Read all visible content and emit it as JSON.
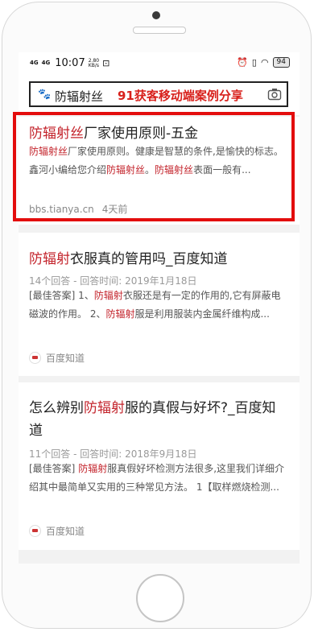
{
  "status_bar": {
    "network_left": "4G",
    "network_right": "4G",
    "time": "10:07",
    "speed_value": "2.80",
    "speed_unit": "KB/s",
    "battery": "94"
  },
  "search": {
    "query": "防辐射丝",
    "overlay_text": "91获客移动端案例分享"
  },
  "results": [
    {
      "title_parts": [
        "防辐射丝",
        "厂家使用原则-五金"
      ],
      "snippet_parts": [
        "防辐射丝",
        "厂家使用原则。健康是智慧的条件,是愉快的标志。鑫河小编给您介绍",
        "防辐射丝",
        "。",
        "防辐射丝",
        "表面一般有..."
      ],
      "source": "bbs.tianya.cn",
      "age": "4天前"
    },
    {
      "title_parts": [
        "防辐射",
        "衣服真的管用吗_百度知道"
      ],
      "meta": "14个回答 - 回答时间: 2019年1月18日",
      "snippet_parts": [
        "[最佳答案] 1、",
        "防辐射",
        "衣服还是有一定的作用的,它有屏蔽电磁波的作用。 2、",
        "防辐射",
        "服是利用服装内金属纤维构成..."
      ],
      "source": "百度知道"
    },
    {
      "title_parts": [
        "怎么辨别",
        "防辐射",
        "服的真假与好坏?_百度知道"
      ],
      "meta": "11个回答 - 回答时间: 2018年9月18日",
      "snippet_parts": [
        "[最佳答案] ",
        "防辐射",
        "服真假好坏检测方法很多,这里我们详细介绍其中最简单又实用的三种常见方法。 1【取样燃烧检测..."
      ],
      "source": "百度知道"
    }
  ]
}
